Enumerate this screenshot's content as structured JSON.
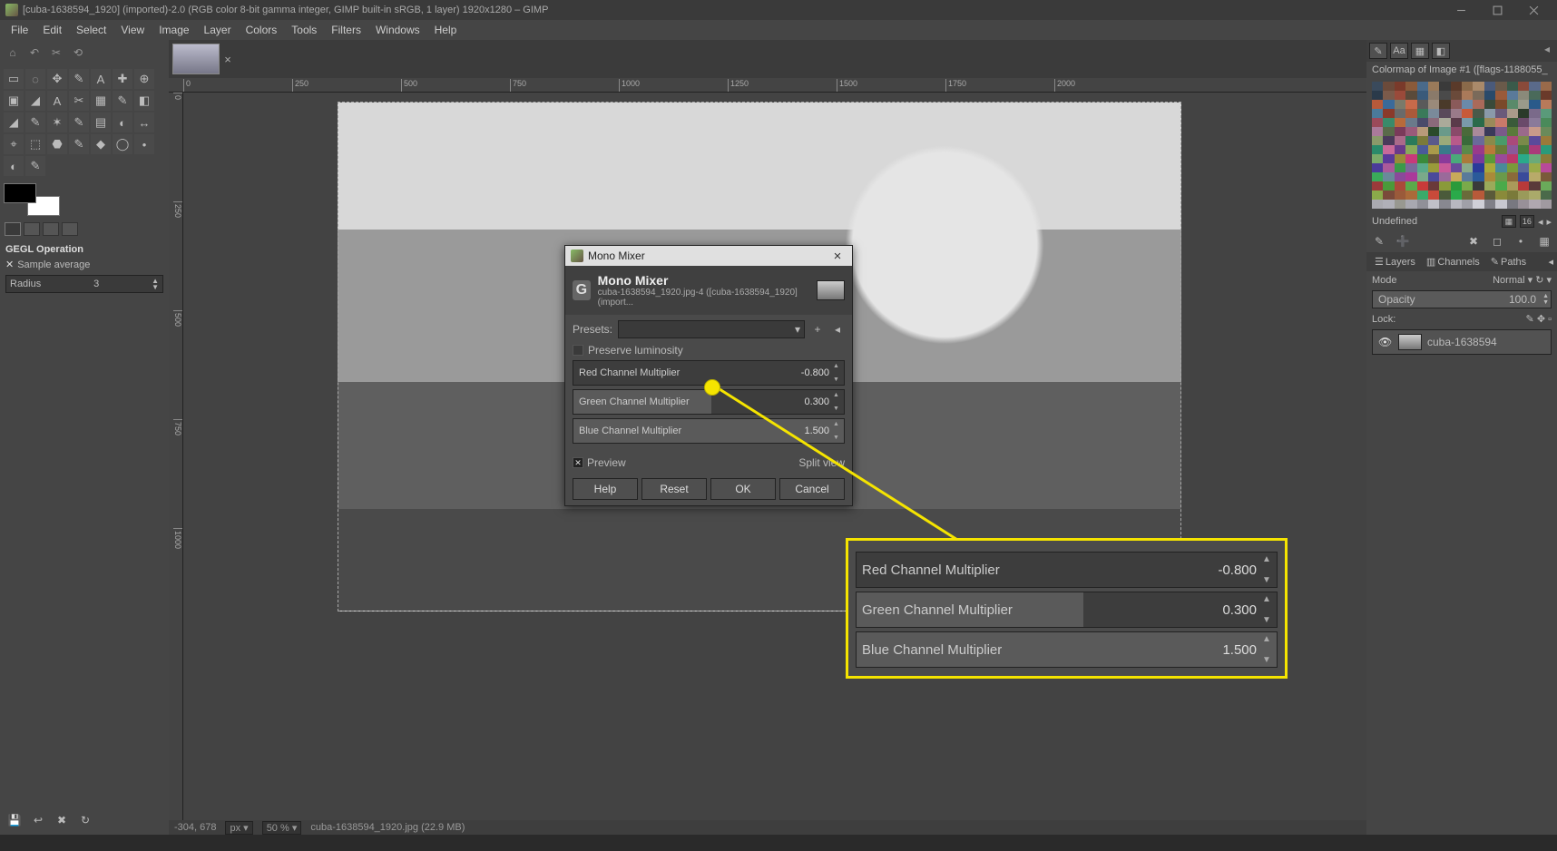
{
  "titlebar": {
    "text": "[cuba-1638594_1920] (imported)-2.0 (RGB color 8-bit gamma integer, GIMP built-in sRGB, 1 layer) 1920x1280 – GIMP"
  },
  "menu": [
    "File",
    "Edit",
    "Select",
    "View",
    "Image",
    "Layer",
    "Colors",
    "Tools",
    "Filters",
    "Windows",
    "Help"
  ],
  "tool_options": {
    "title": "GEGL Operation",
    "sample_average": "Sample average",
    "radius_label": "Radius",
    "radius_value": "3"
  },
  "ruler_marks": [
    "0",
    "250",
    "500",
    "750",
    "1000",
    "1250",
    "1500",
    "1750",
    "2000"
  ],
  "status": {
    "coord": "-304, 678",
    "unit": "px",
    "zoom": "50 %",
    "file": "cuba-1638594_1920.jpg (22.9 MB)"
  },
  "dialog": {
    "window_title": "Mono Mixer",
    "title": "Mono Mixer",
    "subtitle": "cuba-1638594_1920.jpg-4 ([cuba-1638594_1920] (import...",
    "presets_label": "Presets:",
    "preserve_label": "Preserve luminosity",
    "sliders": [
      {
        "label": "Red Channel Multiplier",
        "value": "-0.800",
        "fill": 0
      },
      {
        "label": "Green Channel Multiplier",
        "value": "0.300",
        "fill": 51
      },
      {
        "label": "Blue Channel Multiplier",
        "value": "1.500",
        "fill": 100
      }
    ],
    "preview_label": "Preview",
    "splitview_label": "Split view",
    "buttons": [
      "Help",
      "Reset",
      "OK",
      "Cancel"
    ]
  },
  "callout_sliders": [
    {
      "label": "Red Channel Multiplier",
      "value": "-0.800",
      "fill": 0
    },
    {
      "label": "Green Channel Multiplier",
      "value": "0.300",
      "fill": 54
    },
    {
      "label": "Blue Channel Multiplier",
      "value": "1.500",
      "fill": 100
    }
  ],
  "right": {
    "colormap_title": "Colormap of Image #1 ([flags-1188055_",
    "undefined_label": "Undefined",
    "undefined_count": "16",
    "layers_tab": "Layers",
    "channels_tab": "Channels",
    "paths_tab": "Paths",
    "mode_label": "Mode",
    "mode_value": "Normal",
    "opacity_label": "Opacity",
    "opacity_value": "100.0",
    "lock_label": "Lock:",
    "layer_name": "cuba-1638594"
  },
  "colormap_colors": [
    "#3a4a5c",
    "#6b4a3a",
    "#7a3a2a",
    "#8a5a3a",
    "#4a6a8a",
    "#9a7a5a",
    "#3a3a3a",
    "#5a3a2a",
    "#8a6a4a",
    "#aa8a6a",
    "#4a5a7a",
    "#6a5a4a",
    "#3a5a4a",
    "#8a4a3a",
    "#5a6a8a",
    "#9a6a4a",
    "#2a3a4a",
    "#7a5a4a",
    "#9a4a3a",
    "#5a4a3a",
    "#3a5a7a",
    "#8a7a6a",
    "#4a4a4a",
    "#6a4a3a",
    "#aa7a5a",
    "#7a6a5a",
    "#2a4a6a",
    "#9a5a3a",
    "#5a7a9a",
    "#8a8a7a",
    "#4a6a5a",
    "#6a3a2a",
    "#b85a3a",
    "#3a6a9a",
    "#7a7a6a",
    "#c86a4a",
    "#5a5a5a",
    "#9a8a7a",
    "#4a3a2a",
    "#8a5a5a",
    "#6a8aaa",
    "#aa6a5a",
    "#3a4a3a",
    "#7a4a2a",
    "#5a8a6a",
    "#9a9a8a",
    "#2a5a8a",
    "#b87a5a",
    "#4a7a9a",
    "#8a3a2a",
    "#6a6a6a",
    "#aa5a3a",
    "#3a7a5a",
    "#7a8a9a",
    "#5a4a5a",
    "#9a7a8a",
    "#c85a3a",
    "#4a5a4a",
    "#8a9aaa",
    "#6a5a7a",
    "#aa9a8a",
    "#2a3a2a",
    "#7a6a8a",
    "#5a9a7a",
    "#9a4a5a",
    "#3a8a6a",
    "#b86a3a",
    "#6a7a8a",
    "#4a4a6a",
    "#8a6a7a",
    "#aaaa9a",
    "#5a3a4a",
    "#7a9aaa",
    "#2a6a4a",
    "#9a8a5a",
    "#c87a6a",
    "#3a5a3a",
    "#6a4a6a",
    "#8a7a9a",
    "#4a8a5a",
    "#aa7a9a",
    "#5a6a4a",
    "#7a3a5a",
    "#9a5a7a",
    "#b89a7a",
    "#2a4a2a",
    "#6a9a8a",
    "#8a4a6a",
    "#4a6a3a",
    "#aa8a9a",
    "#3a3a5a",
    "#7a5a8a",
    "#5a7a3a",
    "#9a6a8a",
    "#c89a8a",
    "#6a8a5a",
    "#8a9a6a",
    "#4a3a5a",
    "#aa6a8a",
    "#2a7a5a",
    "#7a7a3a",
    "#5a5a8a",
    "#9aaa7a",
    "#b85a8a",
    "#3a6a3a",
    "#6a6a9a",
    "#8a8a4a",
    "#4a9a6a",
    "#aa4a7a",
    "#7a8a4a",
    "#5a4a9a",
    "#9a7a3a",
    "#2a8a6a",
    "#c86a9a",
    "#6a3a8a",
    "#8aaa5a",
    "#4a5a9a",
    "#aa9a4a",
    "#3a7a8a",
    "#7a4a9a",
    "#5a8a4a",
    "#9a3a8a",
    "#b87a3a",
    "#6a7a3a",
    "#8a5a9a",
    "#4a7a3a",
    "#aa3a7a",
    "#2a9a7a",
    "#7aaa6a",
    "#5a3a9a",
    "#9a8a3a",
    "#c83a7a",
    "#3a8a3a",
    "#6a5a3a",
    "#8a3a9a",
    "#4aaa7a",
    "#aa7a3a",
    "#7a3a9a",
    "#5a9a3a",
    "#9a4a9a",
    "#b83a6a",
    "#2aaa8a",
    "#6aaa7a",
    "#8a7a3a",
    "#4a3a9a",
    "#aa5a9a",
    "#3a9a4a",
    "#7a6a9a",
    "#5aaa8a",
    "#9a9a3a",
    "#c85a9a",
    "#6a4a9a",
    "#8aaa8a",
    "#2a3a9a",
    "#aaaa3a",
    "#4a8a9a",
    "#7a9a3a",
    "#5a6a9a",
    "#9aaa4a",
    "#b84a9a",
    "#3aaa5a",
    "#6a8a9a",
    "#8a4a9a",
    "#aa3a9a",
    "#7aaa8a",
    "#4a4a9a",
    "#9a6a9a",
    "#c8aa5a",
    "#5a7a9a",
    "#2a5a9a",
    "#aa8a3a",
    "#6a9a4a",
    "#8a6a3a",
    "#3a4a9a",
    "#b8aa6a",
    "#7a5a3a",
    "#9a3a3a",
    "#4a9a3a",
    "#aa4a3a",
    "#5aaa4a",
    "#c83a3a",
    "#6a3a3a",
    "#8a9a3a",
    "#2a9a3a",
    "#7aaa4a",
    "#3a3a3a",
    "#9aaa5a",
    "#4aaa4a",
    "#aa9a5a",
    "#b83a3a",
    "#5a3a3a",
    "#6aaa5a",
    "#8aaa4a",
    "#7a4a3a",
    "#9a5a3a",
    "#aa6a3a",
    "#3aaa6a",
    "#c84a3a",
    "#4a5a3a",
    "#2aaa4a",
    "#6a6a3a",
    "#b85a3a",
    "#5a5a3a",
    "#8a8a3a",
    "#7a7a3a",
    "#9a9a5a",
    "#aaaa6a",
    "#4a6a4a",
    "#aaaab0",
    "#b0b0b8",
    "#989890",
    "#a8a8b0",
    "#909098",
    "#c0c0c8",
    "#888890",
    "#b8b8c0",
    "#a0a0a8",
    "#d0d0d8",
    "#808088",
    "#c8c8d0",
    "#787880",
    "#989098",
    "#b0a8b0",
    "#a09aa0"
  ]
}
